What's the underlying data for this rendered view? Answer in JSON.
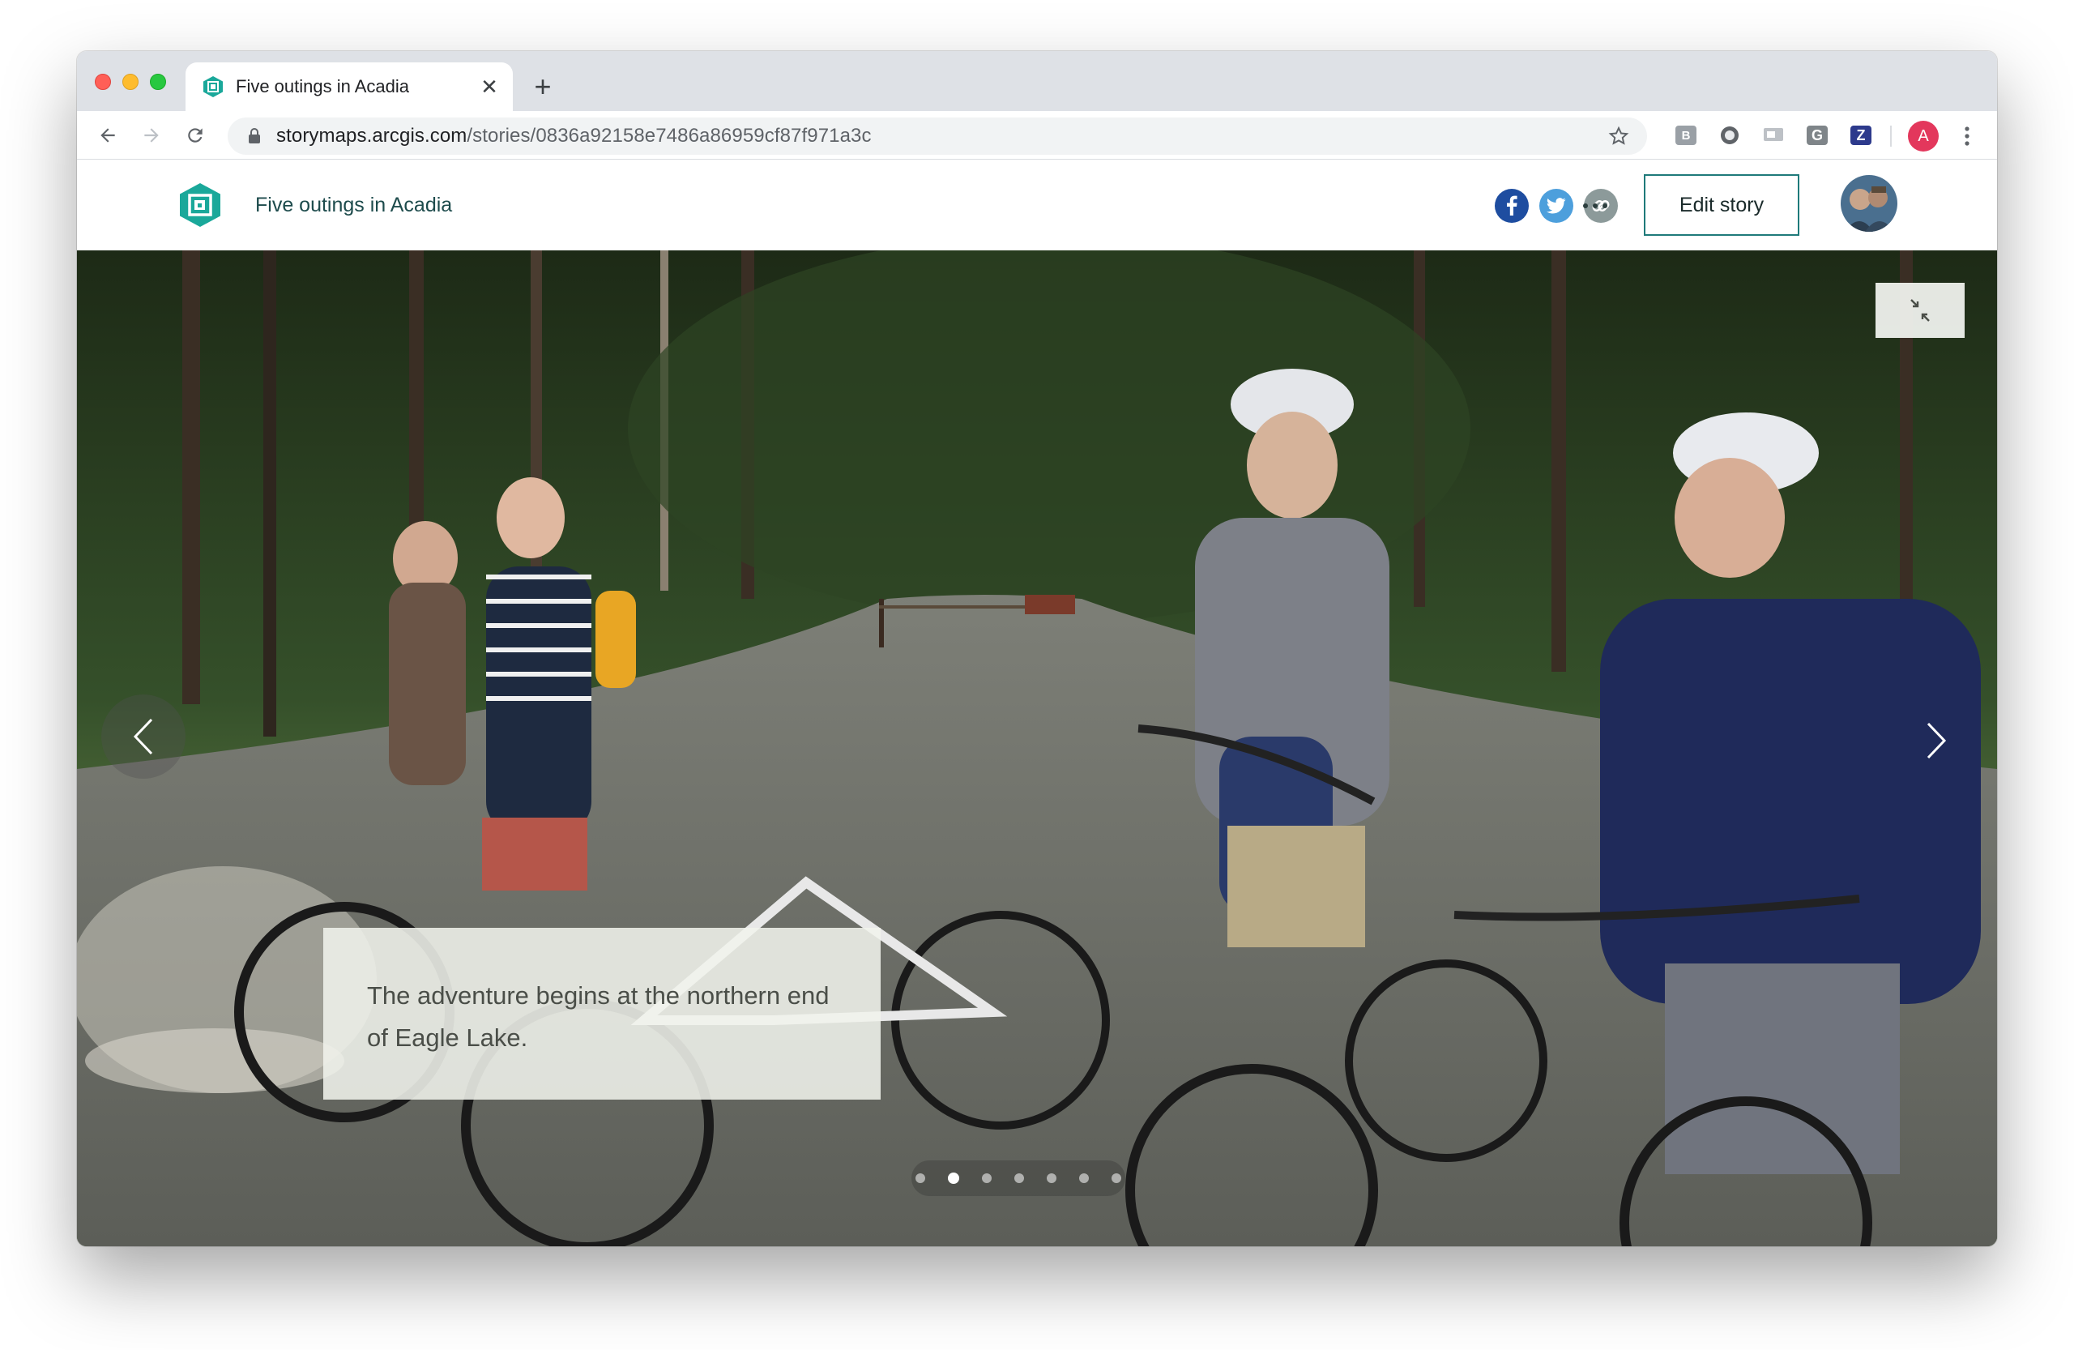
{
  "browser": {
    "tab_title": "Five outings in Acadia",
    "tab_close": "✕",
    "new_tab": "+",
    "url_host": "storymaps.arcgis.com",
    "url_path": "/stories/0836a92158e7486a86959cf87f971a3c",
    "extensions": [
      "B",
      "",
      "",
      "G",
      "Z"
    ],
    "profile_initial": "A"
  },
  "story": {
    "title": "Five outings in Acadia",
    "share": [
      "facebook-icon",
      "twitter-icon",
      "link-icon"
    ],
    "edit_label": "Edit story"
  },
  "slideshow": {
    "caption": "The adventure begins at the northern end of Eagle Lake.",
    "slide_count": 7,
    "active_slide": 2
  },
  "colors": {
    "brand_teal": "#1aa89a",
    "facebook": "#3b5998",
    "twitter": "#4d9fdc",
    "link": "#8c9a9a",
    "profile": "#e3375c"
  }
}
